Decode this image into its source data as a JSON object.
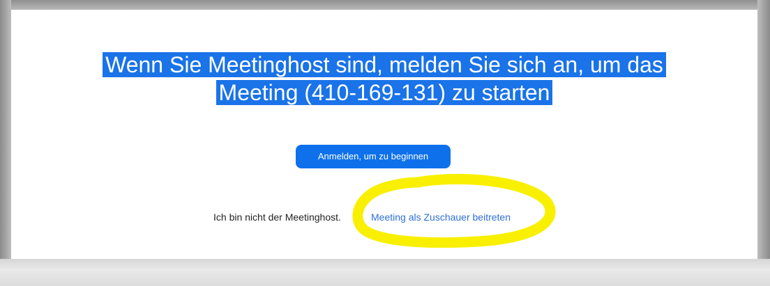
{
  "headline": {
    "line1": "Wenn Sie Meetinghost sind, melden Sie sich an, um das",
    "line2": "Meeting (410-169-131) zu starten"
  },
  "signin_button": {
    "label": "Anmelden, um zu beginnen"
  },
  "non_host": {
    "text": "Ich bin nicht der Meetinghost.",
    "join_link": "Meeting als Zuschauer beitreten"
  },
  "colors": {
    "accent_blue": "#0e71eb",
    "selection_blue": "#1a73e8",
    "link_blue": "#2d6fdb",
    "marker_yellow": "#f8f000"
  }
}
